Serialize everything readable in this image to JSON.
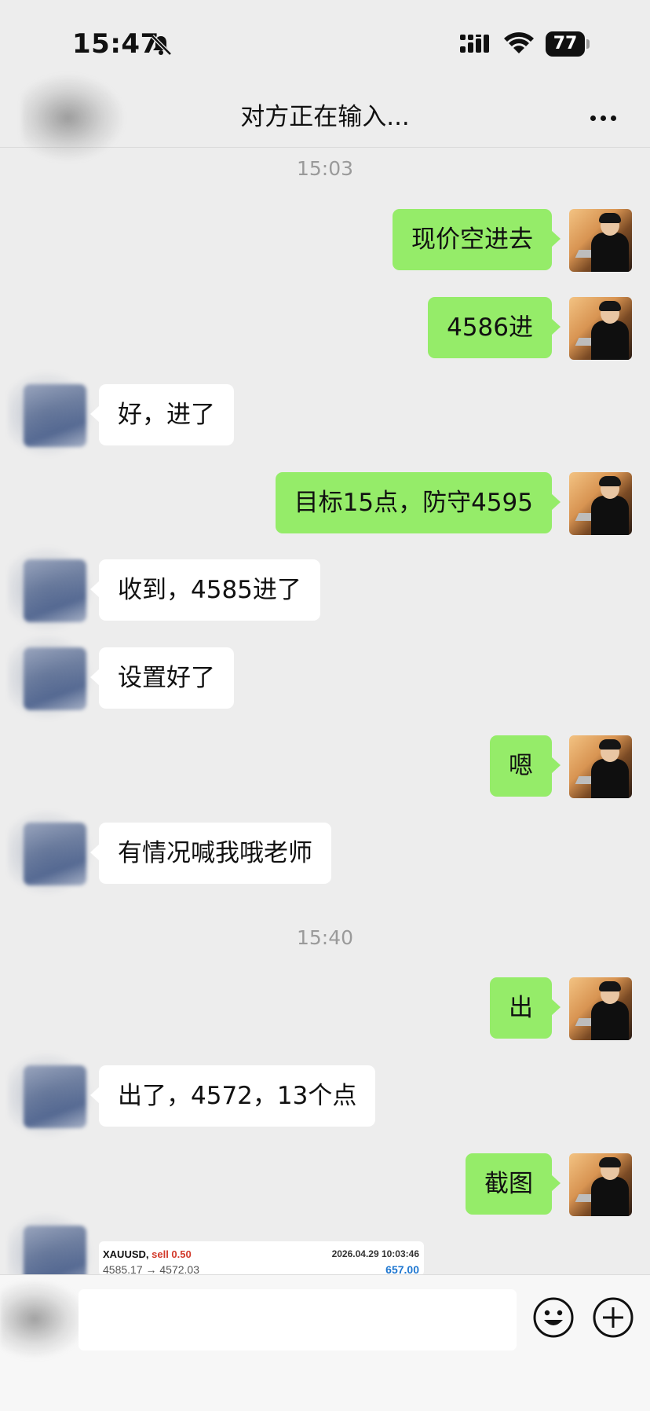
{
  "status_bar": {
    "time": "15:47",
    "battery": "77"
  },
  "header": {
    "title": "对方正在输入..."
  },
  "messages": [
    {
      "type": "timestamp",
      "text": "15:03"
    },
    {
      "type": "me",
      "text": "现价空进去"
    },
    {
      "type": "me",
      "text": "4586进"
    },
    {
      "type": "them",
      "text": "好，进了"
    },
    {
      "type": "me",
      "text": "目标15点，防守4595"
    },
    {
      "type": "them",
      "text": "收到，4585进了"
    },
    {
      "type": "them",
      "text": "设置好了"
    },
    {
      "type": "me",
      "text": "嗯"
    },
    {
      "type": "them",
      "text": "有情况喊我哦老师"
    },
    {
      "type": "timestamp",
      "text": "15:40"
    },
    {
      "type": "me",
      "text": "出"
    },
    {
      "type": "them",
      "text": "出了，4572，13个点"
    },
    {
      "type": "me",
      "text": "截图"
    }
  ],
  "trade_card": {
    "symbol": "XAUUSD,",
    "action": "sell 0.50",
    "datetime": "2026.04.29 10:03:46",
    "prices": "4585.17 → 4572.03",
    "profit": "657.00"
  },
  "icons": {
    "silent": "bell-slash-icon",
    "signal": "cellular-signal-icon",
    "wifi": "wifi-icon",
    "more": "more-dots-icon",
    "emoji": "emoji-icon",
    "plus": "plus-circle-icon"
  },
  "colors": {
    "my_bubble": "#95ec69",
    "their_bubble": "#ffffff",
    "background": "#ededed"
  }
}
